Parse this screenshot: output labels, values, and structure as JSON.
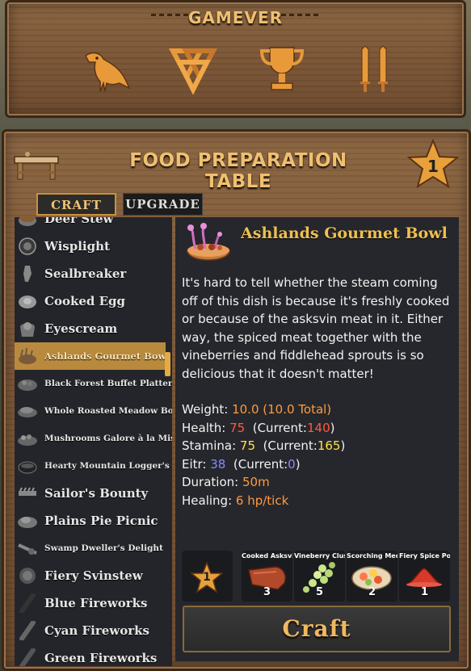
{
  "header": {
    "title": "GAMEVER",
    "icons": [
      "raven-icon",
      "valknut-icon",
      "trophy-icon",
      "swords-icon"
    ]
  },
  "station": {
    "title": "FOOD PREPARATION TABLE",
    "level": "1",
    "icon": "prep-table-icon"
  },
  "tabs": {
    "craft": "CRAFT",
    "upgrade": "UPGRADE"
  },
  "recipes": [
    {
      "label": "Deer Stew",
      "icon": "stew-icon"
    },
    {
      "label": "Wisplight",
      "icon": "wisp-icon"
    },
    {
      "label": "Sealbreaker",
      "icon": "sealbreaker-icon"
    },
    {
      "label": "Cooked Egg",
      "icon": "egg-icon"
    },
    {
      "label": "Eyescream",
      "icon": "eyescream-icon"
    },
    {
      "label": "Ashlands Gourmet Bowl",
      "icon": "gourmet-bowl-icon",
      "selected": true
    },
    {
      "label": "Black Forest Buffet Platter",
      "icon": "platter-icon"
    },
    {
      "label": "Whole Roasted Meadow Boar",
      "icon": "boar-icon"
    },
    {
      "label": "Mushrooms Galore à la Mistlands",
      "icon": "mushroom-platter-icon"
    },
    {
      "label": "Hearty Mountain Logger's Stew",
      "icon": "logger-stew-icon"
    },
    {
      "label": "Sailor's Bounty",
      "icon": "bounty-icon"
    },
    {
      "label": "Plains Pie Picnic",
      "icon": "pie-icon"
    },
    {
      "label": "Swamp Dweller's Delight",
      "icon": "swamp-dish-icon"
    },
    {
      "label": "Fiery Svinstew",
      "icon": "svinstew-icon"
    },
    {
      "label": "Blue Fireworks",
      "icon": "firework-blue-icon"
    },
    {
      "label": "Cyan Fireworks",
      "icon": "firework-cyan-icon"
    },
    {
      "label": "Green Fireworks",
      "icon": "firework-green-icon"
    }
  ],
  "item": {
    "name": "Ashlands Gourmet Bowl",
    "description": "It's hard to tell whether the steam coming off of this dish is because it's freshly cooked or because of the asksvin meat in it. Either way, the spiced meat together with the vineberries and fiddlehead sprouts is so delicious that it doesn't matter!",
    "stats": {
      "weight_label": "Weight:",
      "weight_value": "10.0 (10.0 Total)",
      "health_label": "Health:",
      "health_value": "75",
      "health_current_label": "(Current:",
      "health_current": "140",
      "health_close": ")",
      "stamina_label": "Stamina:",
      "stamina_value": "75",
      "stamina_current_label": "(Current:",
      "stamina_current": "165",
      "stamina_close": ")",
      "eitr_label": "Eitr:",
      "eitr_value": "38",
      "eitr_current_label": "(Current:",
      "eitr_current": "0",
      "eitr_close": ")",
      "duration_label": "Duration:",
      "duration_value": "50m",
      "healing_label": "Healing:",
      "healing_value": "6 hp/tick"
    }
  },
  "requirements": {
    "level": "1",
    "items": [
      {
        "name": "Cooked Asksvin Tail",
        "qty": "3",
        "icon": "asksvin-tail-icon"
      },
      {
        "name": "Vineberry Cluster",
        "qty": "5",
        "icon": "vineberry-icon"
      },
      {
        "name": "Scorching Medley",
        "qty": "2",
        "icon": "medley-icon"
      },
      {
        "name": "Fiery Spice Powder",
        "qty": "1",
        "icon": "spice-powder-icon"
      }
    ]
  },
  "craft_button": "Craft",
  "colors": {
    "accent": "#f0c070",
    "selected_row": "#b98a3e",
    "stat_orange": "#ff9a3c",
    "stat_red": "#ff5a3c",
    "stat_yellow": "#ffe04a",
    "stat_blue": "#8a8aff"
  }
}
